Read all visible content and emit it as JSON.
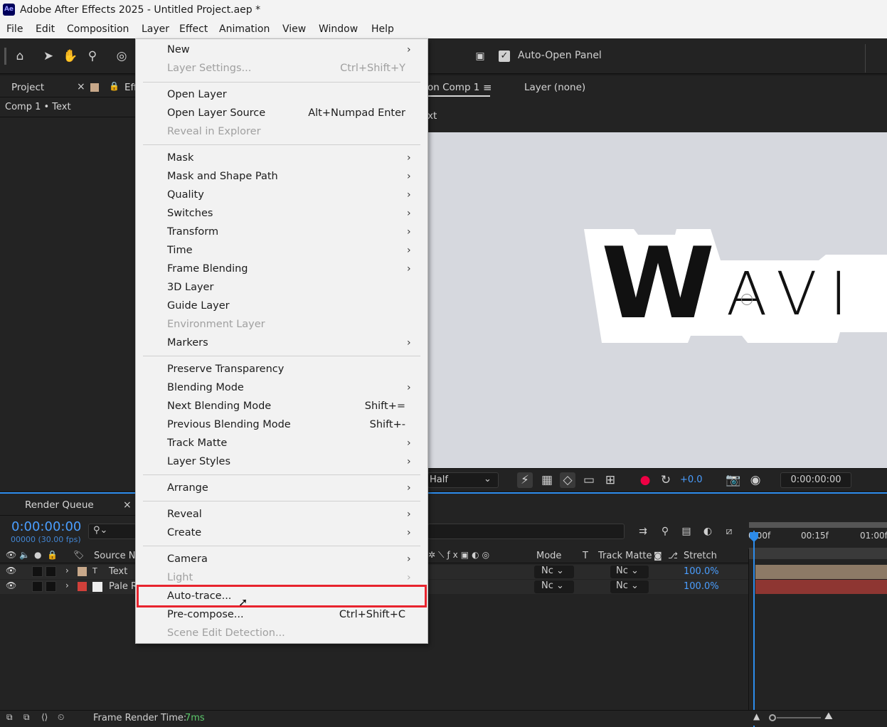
{
  "titlebar": {
    "app_icon": "Ae",
    "title": "Adobe After Effects 2025 - Untitled Project.aep *"
  },
  "menubar": [
    "File",
    "Edit",
    "Composition",
    "Layer",
    "Effect",
    "Animation",
    "View",
    "Window",
    "Help"
  ],
  "toolbar": {
    "auto_open_label": "Auto-Open Panel",
    "auto_open_checked": true
  },
  "project_panel": {
    "tab": "Project",
    "tab2": "Eff",
    "breadcrumb": "Comp 1 • Text"
  },
  "comp_panel": {
    "tab": "on Comp 1",
    "layer_tab": "Layer (none)",
    "sub": "xt"
  },
  "viewer": {
    "text_big": "W",
    "text_small": "AVI",
    "resolution": "Half",
    "exposure": "+0.0",
    "timecode": "0:00:00:00"
  },
  "timeline": {
    "render_queue_tab": "Render Queue",
    "timecode": "0:00:00:00",
    "frame_info": "00000 (30.00 fps)",
    "search_placeholder": "",
    "col_source": "Source Na",
    "col_mode": "Mode",
    "col_t": "T",
    "col_trackmatte": "Track Matte",
    "col_stretch": "Stretch",
    "ruler": [
      "0:00f",
      "00:15f",
      "01:00f"
    ],
    "layers": [
      {
        "name": "Text",
        "mode": "Nc",
        "matte": "Nc",
        "stretch": "100.0%",
        "label_color": "#c8a88a"
      },
      {
        "name": "Pale R",
        "mode": "Nc",
        "matte": "Nc",
        "stretch": "100.0%",
        "label_color": "#d0403a"
      }
    ]
  },
  "status": {
    "label": "Frame Render Time:",
    "value": "7ms"
  },
  "menu": [
    {
      "label": "New",
      "arrow": true
    },
    {
      "label": "Layer Settings...",
      "shortcut": "Ctrl+Shift+Y",
      "disabled": true
    },
    {
      "label": "Open Layer"
    },
    {
      "label": "Open Layer Source",
      "shortcut": "Alt+Numpad Enter"
    },
    {
      "label": "Reveal in Explorer",
      "disabled": true
    },
    {
      "label": "Mask",
      "arrow": true
    },
    {
      "label": "Mask and Shape Path",
      "arrow": true
    },
    {
      "label": "Quality",
      "arrow": true
    },
    {
      "label": "Switches",
      "arrow": true
    },
    {
      "label": "Transform",
      "arrow": true
    },
    {
      "label": "Time",
      "arrow": true
    },
    {
      "label": "Frame Blending",
      "arrow": true
    },
    {
      "label": "3D Layer"
    },
    {
      "label": "Guide Layer"
    },
    {
      "label": "Environment Layer",
      "disabled": true
    },
    {
      "label": "Markers",
      "arrow": true
    },
    {
      "label": "Preserve Transparency"
    },
    {
      "label": "Blending Mode",
      "arrow": true
    },
    {
      "label": "Next Blending Mode",
      "shortcut": "Shift+="
    },
    {
      "label": "Previous Blending Mode",
      "shortcut": "Shift+-"
    },
    {
      "label": "Track Matte",
      "arrow": true
    },
    {
      "label": "Layer Styles",
      "arrow": true
    },
    {
      "label": "Arrange",
      "arrow": true
    },
    {
      "label": "Reveal",
      "arrow": true
    },
    {
      "label": "Create",
      "arrow": true
    },
    {
      "label": "Camera",
      "arrow": true
    },
    {
      "label": "Light",
      "arrow": true,
      "disabled": true
    },
    {
      "label": "Auto-trace...",
      "highlighted": true
    },
    {
      "label": "Pre-compose...",
      "shortcut": "Ctrl+Shift+C"
    },
    {
      "label": "Scene Edit Detection...",
      "disabled": true
    }
  ],
  "colors": {
    "accent_blue": "#4a9eff",
    "highlight_red": "#e8242e",
    "timeline_blue": "#2d8ceb"
  }
}
